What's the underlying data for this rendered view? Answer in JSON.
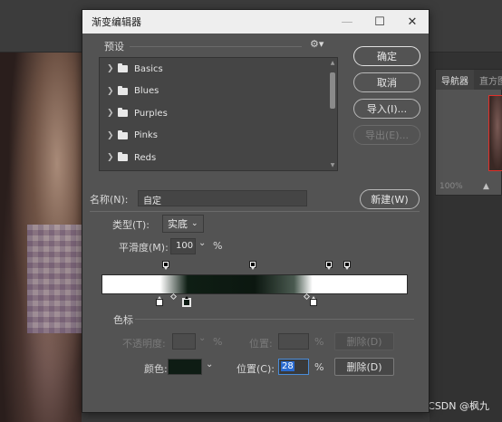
{
  "dialog": {
    "title": "渐变编辑器",
    "window_buttons": [
      "—",
      "☐",
      "✕"
    ],
    "presets_label": "预设",
    "presets": [
      "Basics",
      "Blues",
      "Purples",
      "Pinks",
      "Reds"
    ],
    "name_label": "名称(N):",
    "name_value": "自定",
    "type_label": "类型(T):",
    "type_value": "实底",
    "smoothness_label": "平滑度(M):",
    "smoothness_value": "100",
    "smoothness_unit": "%",
    "color_stops_label": "色标",
    "opacity_label": "不透明度:",
    "opacity_unit": "%",
    "opacity_location_label": "位置:",
    "opacity_location_unit": "%",
    "opacity_delete_label": "删除(D)",
    "color_label": "颜色:",
    "color_value": "#0e1c14",
    "color_location_label": "位置(C):",
    "color_location_value": "28",
    "color_location_unit": "%",
    "color_delete_label": "删除(D)"
  },
  "buttons": {
    "ok": "确定",
    "cancel": "取消",
    "import": "导入(I)...",
    "export": "导出(E)...",
    "new": "新建(W)"
  },
  "background": {
    "navigator_tab": "导航器",
    "histogram_tab": "直方图",
    "zoom_text": "100%",
    "watermark": "CSDN @枫九"
  }
}
